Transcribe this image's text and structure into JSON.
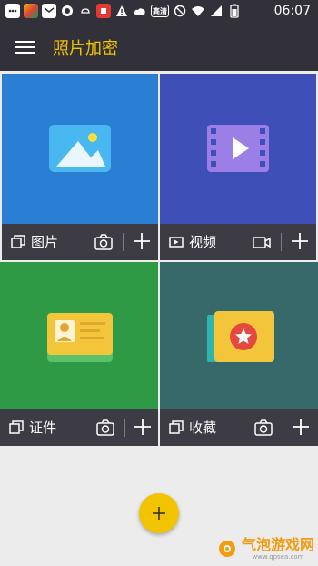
{
  "status_bar": {
    "time": "06:07",
    "icons": [
      "message-icon",
      "app-icon",
      "mail-icon",
      "chat-icon",
      "weather-icon",
      "notification-icon",
      "warning-icon",
      "cloud-icon",
      "hd-icon",
      "do-not-disturb-icon",
      "wifi-icon",
      "signal-icon",
      "battery-icon"
    ],
    "hd_text": "高清"
  },
  "app_bar": {
    "title": "照片加密"
  },
  "tiles": [
    {
      "label": "图片",
      "color": "#2a7fd4"
    },
    {
      "label": "视频",
      "color": "#3f4fb8"
    },
    {
      "label": "证件",
      "color": "#2f9a45"
    },
    {
      "label": "收藏",
      "color": "#37696a"
    }
  ],
  "fab": {
    "symbol": "+"
  },
  "watermark": {
    "text": "气泡游戏网",
    "url": "www.qpsea.com"
  },
  "colors": {
    "accent": "#f2c400",
    "bar": "#3d3c44",
    "appbar": "#32313a"
  }
}
